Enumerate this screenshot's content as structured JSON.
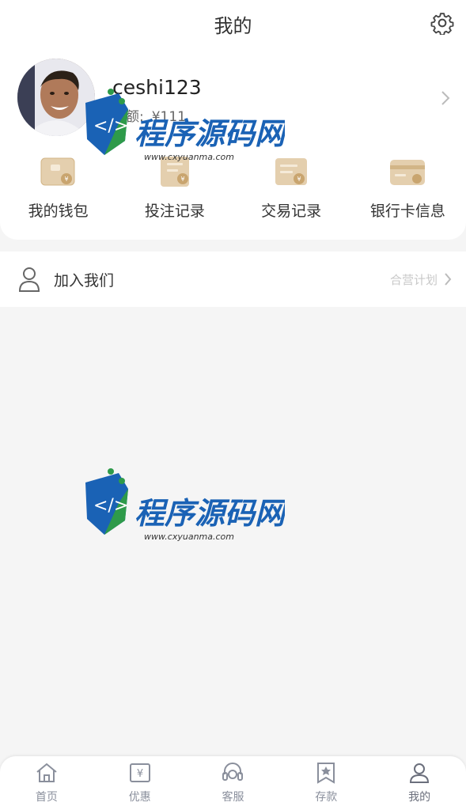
{
  "header": {
    "title": "我的"
  },
  "profile": {
    "username": "ceshi123",
    "balance_label": "余额:",
    "balance_value": "¥111"
  },
  "quick_actions": [
    {
      "label": "我的钱包",
      "icon": "wallet-icon"
    },
    {
      "label": "投注记录",
      "icon": "bet-record-icon"
    },
    {
      "label": "交易记录",
      "icon": "transaction-record-icon"
    },
    {
      "label": "银行卡信息",
      "icon": "bank-card-icon"
    }
  ],
  "join": {
    "label": "加入我们",
    "sub_label": "合营计划"
  },
  "watermark": {
    "title": "程序源码网",
    "url": "www.cxyuanma.com"
  },
  "tabbar": [
    {
      "label": "首页",
      "icon": "home-icon"
    },
    {
      "label": "优惠",
      "icon": "coupon-icon"
    },
    {
      "label": "客服",
      "icon": "headset-icon"
    },
    {
      "label": "存款",
      "icon": "deposit-icon"
    },
    {
      "label": "我的",
      "icon": "user-icon",
      "active": true
    }
  ],
  "colors": {
    "accent_gold": "#d6b98f",
    "tab_text": "#8a8f9c",
    "watermark_blue": "#1a62b5"
  }
}
